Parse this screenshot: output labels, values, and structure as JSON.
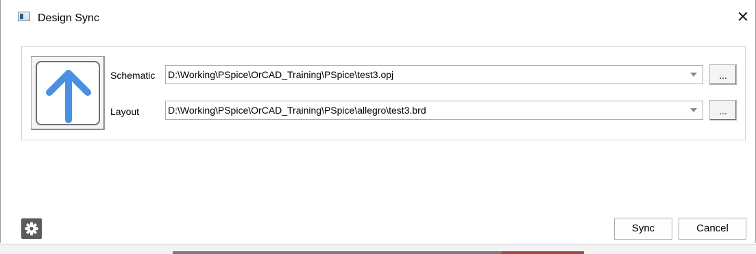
{
  "window": {
    "title": "Design Sync",
    "close_glyph": "✕",
    "icon": "app-window-icon"
  },
  "sync": {
    "direction_icon": "arrow-up-icon",
    "accent": "#4a90e2"
  },
  "schematic": {
    "label": "Schematic",
    "value": "D:\\Working\\PSpice\\OrCAD_Training\\PSpice\\test3.opj",
    "browse_label": "..."
  },
  "layout": {
    "label": "Layout",
    "value": "D:\\Working\\PSpice\\OrCAD_Training\\PSpice\\allegro\\test3.brd",
    "browse_label": "..."
  },
  "footer": {
    "settings_icon": "gear-icon",
    "sync_label": "Sync",
    "cancel_label": "Cancel"
  }
}
